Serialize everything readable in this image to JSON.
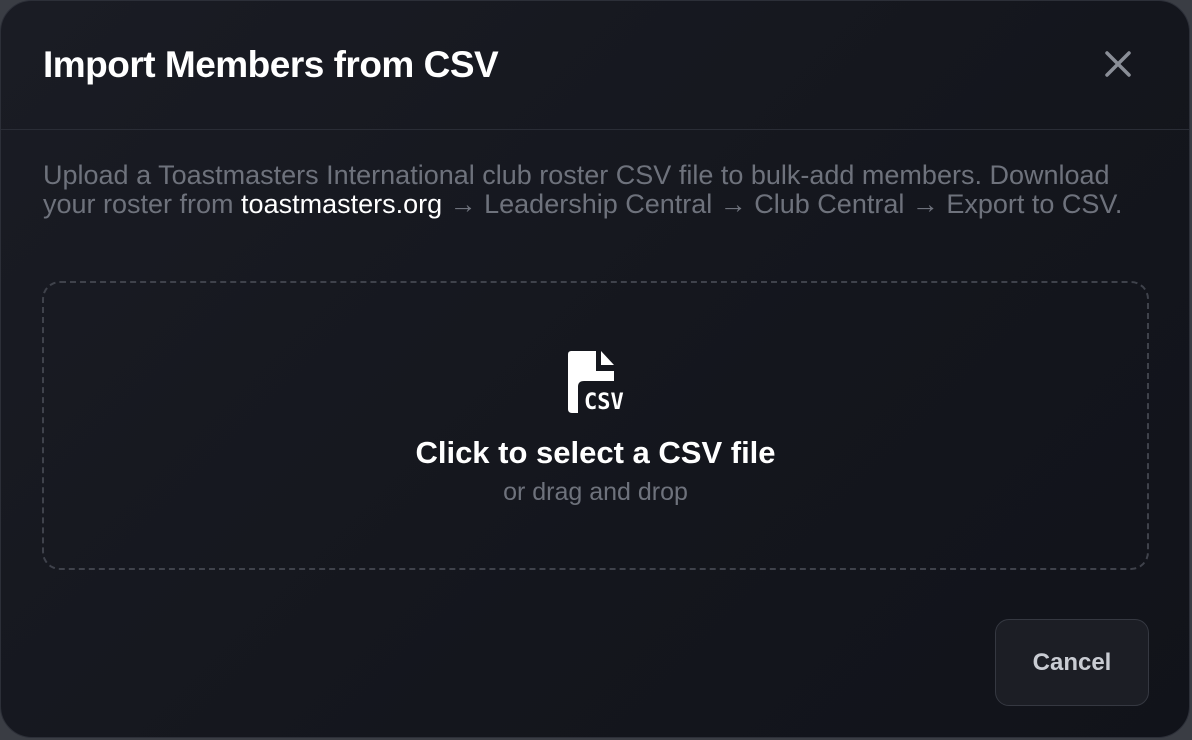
{
  "dialog": {
    "title": "Import Members from CSV",
    "close_icon": "close-icon"
  },
  "description": {
    "text_before": "Upload a Toastmasters International club roster CSV file to bulk-add members. Download your roster from ",
    "link_text": "toastmasters.org",
    "text_after": " → Leadership Central → Club Central → Export to CSV."
  },
  "dropzone": {
    "icon": "csv-file-icon",
    "icon_text": "CSV",
    "title": "Click to select a CSV file",
    "subtitle": "or drag and drop"
  },
  "footer": {
    "cancel_label": "Cancel"
  },
  "colors": {
    "background": "#14161d",
    "muted_text": "#6e727c",
    "primary_text": "#ffffff",
    "border": "#2a2d36"
  }
}
